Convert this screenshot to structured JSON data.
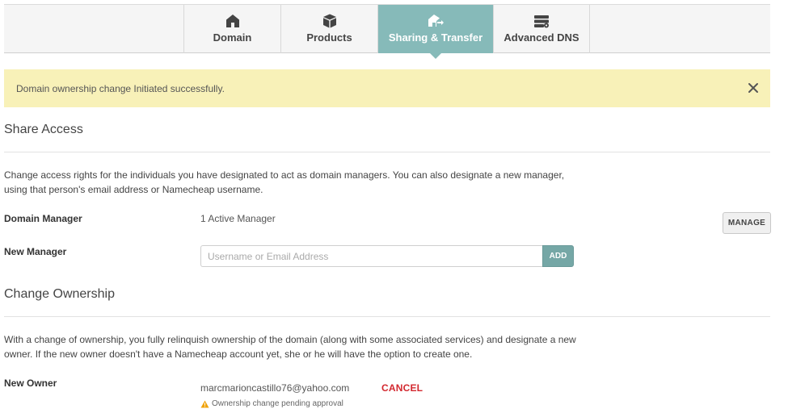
{
  "tabs": [
    {
      "label": "Domain",
      "icon": "house-icon",
      "active": false
    },
    {
      "label": "Products",
      "icon": "box-icon",
      "active": false
    },
    {
      "label": "Sharing & Transfer",
      "icon": "house-transfer-icon",
      "active": true
    },
    {
      "label": "Advanced DNS",
      "icon": "server-settings-icon",
      "active": false
    }
  ],
  "alert": {
    "message": "Domain ownership change Initiated successfully.",
    "color": "#f8f1b8"
  },
  "share_access": {
    "title": "Share Access",
    "description": "Change access rights for the individuals you have designated to act as domain managers. You can also designate a new manager, using that person's email address or Namecheap username.",
    "domain_manager_label": "Domain Manager",
    "domain_manager_value": "1 Active Manager",
    "manage_label": "MANAGE",
    "new_manager_label": "New Manager",
    "new_manager_placeholder": "Username or Email Address",
    "add_label": "ADD"
  },
  "change_ownership": {
    "title": "Change Ownership",
    "description": "With a change of ownership, you fully relinquish ownership of the domain (along with some associated services) and designate a new owner. If the new owner doesn't have a Namecheap account yet, she or he will have the option to create one.",
    "new_owner_label": "New Owner",
    "new_owner_email": "marcmarioncastillo76@yahoo.com",
    "cancel_label": "CANCEL",
    "pending_status": "Ownership change pending approval"
  },
  "colors": {
    "accent": "#86bab9",
    "add_button": "#75a7a6",
    "cancel": "#d3282f",
    "warning": "#f0a30a"
  }
}
